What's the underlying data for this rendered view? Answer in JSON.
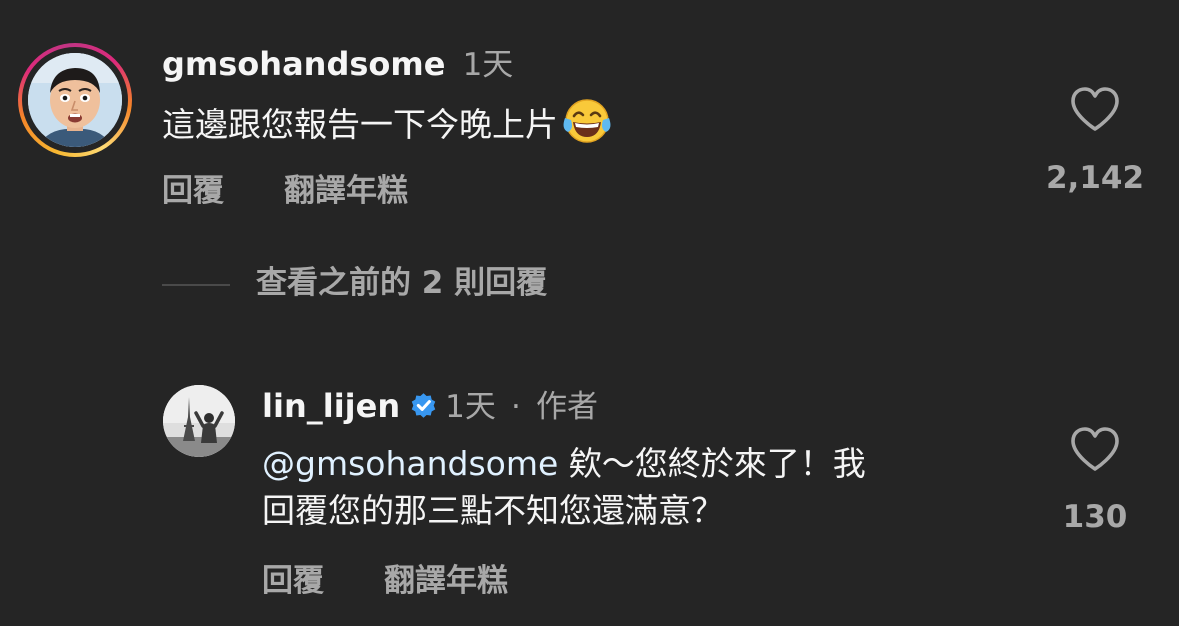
{
  "comment": {
    "username": "gmsohandsome",
    "time": "1天",
    "text": "這邊跟您報告一下今晚上片",
    "emoji_icon": "tears-of-joy-emoji-icon",
    "reply_label": "回覆",
    "translate_label": "翻譯年糕",
    "like_count": "2,142",
    "story_ring_colors": [
      "#feda75",
      "#f58529",
      "#dd2a7b",
      "#c13584"
    ]
  },
  "view_replies": {
    "label": "查看之前的 2 則回覆"
  },
  "reply": {
    "username": "lin_lijen",
    "verified_icon": "verified-badge-icon",
    "time": "1天",
    "separator": "·",
    "author_label": "作者",
    "mention": "@gmsohandsome",
    "text_line1": " 欸～您終於來了！我",
    "text_line2": "回覆您的那三點不知您還滿意？",
    "reply_label": "回覆",
    "translate_label": "翻譯年糕",
    "like_count": "130"
  },
  "colors": {
    "background": "#252525",
    "primary_text": "#f5f5f5",
    "secondary_text": "#a8a8a8",
    "mention": "#e0f1ff",
    "verified": "#3897f0"
  }
}
